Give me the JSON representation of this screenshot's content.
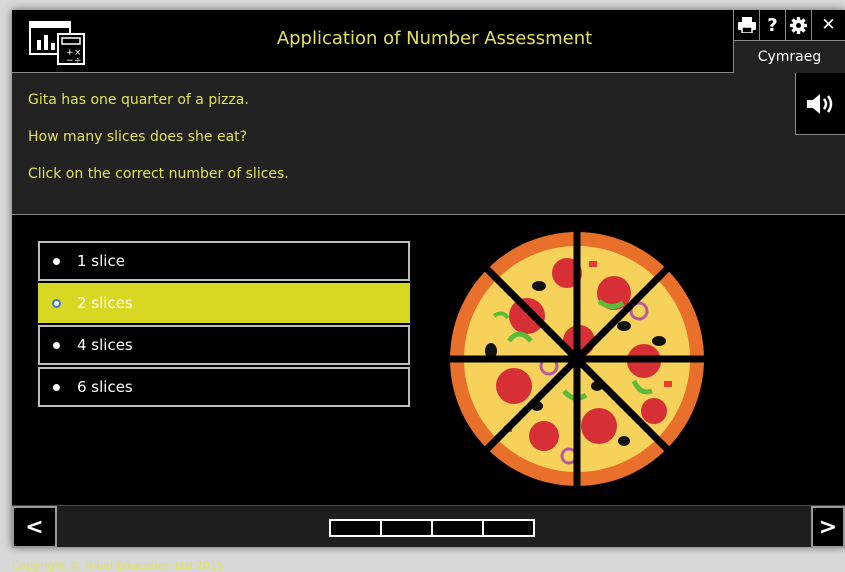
{
  "header": {
    "title": "Application of Number Assessment",
    "language_label": "Cymraeg",
    "icons": [
      "print-icon",
      "help-icon",
      "settings-icon",
      "close-icon"
    ],
    "help_glyph": "?",
    "close_glyph": "✕"
  },
  "question": {
    "lines": [
      "Gita has one quarter of a pizza.",
      "How many slices does she eat?",
      "Click on the correct number of slices."
    ],
    "audio_icon": "speaker-icon"
  },
  "options": [
    {
      "label": "1 slice",
      "selected": false
    },
    {
      "label": "2 slices",
      "selected": true
    },
    {
      "label": "4 slices",
      "selected": false
    },
    {
      "label": "6 slices",
      "selected": false
    }
  ],
  "navigation": {
    "prev_glyph": "<",
    "next_glyph": ">",
    "progress_segments": 4
  },
  "footer": {
    "copyright": "Copyright © Tribal Education Ltd 2015"
  },
  "colors": {
    "accent_text": "#e3e25a",
    "selected_option": "#d8d822",
    "background": "#000000",
    "panel": "#222222"
  }
}
